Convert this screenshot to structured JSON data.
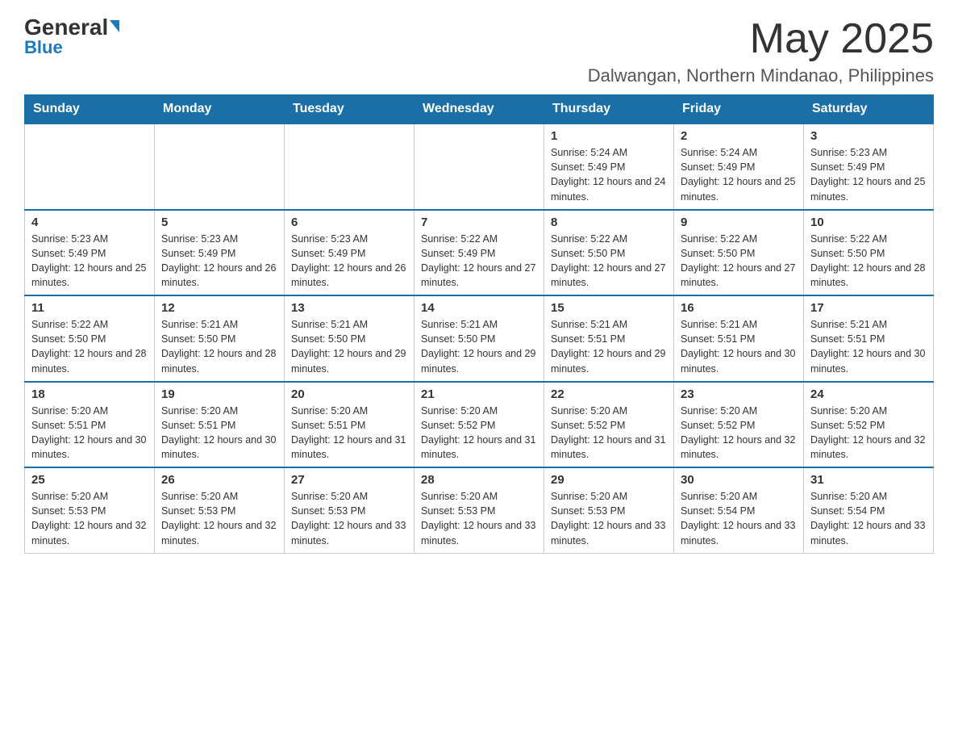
{
  "logo": {
    "part1": "General",
    "part2": "Blue"
  },
  "header": {
    "month": "May 2025",
    "location": "Dalwangan, Northern Mindanao, Philippines"
  },
  "days_of_week": [
    "Sunday",
    "Monday",
    "Tuesday",
    "Wednesday",
    "Thursday",
    "Friday",
    "Saturday"
  ],
  "weeks": [
    {
      "days": [
        {
          "num": "",
          "info": ""
        },
        {
          "num": "",
          "info": ""
        },
        {
          "num": "",
          "info": ""
        },
        {
          "num": "",
          "info": ""
        },
        {
          "num": "1",
          "info": "Sunrise: 5:24 AM\nSunset: 5:49 PM\nDaylight: 12 hours and 24 minutes."
        },
        {
          "num": "2",
          "info": "Sunrise: 5:24 AM\nSunset: 5:49 PM\nDaylight: 12 hours and 25 minutes."
        },
        {
          "num": "3",
          "info": "Sunrise: 5:23 AM\nSunset: 5:49 PM\nDaylight: 12 hours and 25 minutes."
        }
      ]
    },
    {
      "days": [
        {
          "num": "4",
          "info": "Sunrise: 5:23 AM\nSunset: 5:49 PM\nDaylight: 12 hours and 25 minutes."
        },
        {
          "num": "5",
          "info": "Sunrise: 5:23 AM\nSunset: 5:49 PM\nDaylight: 12 hours and 26 minutes."
        },
        {
          "num": "6",
          "info": "Sunrise: 5:23 AM\nSunset: 5:49 PM\nDaylight: 12 hours and 26 minutes."
        },
        {
          "num": "7",
          "info": "Sunrise: 5:22 AM\nSunset: 5:49 PM\nDaylight: 12 hours and 27 minutes."
        },
        {
          "num": "8",
          "info": "Sunrise: 5:22 AM\nSunset: 5:50 PM\nDaylight: 12 hours and 27 minutes."
        },
        {
          "num": "9",
          "info": "Sunrise: 5:22 AM\nSunset: 5:50 PM\nDaylight: 12 hours and 27 minutes."
        },
        {
          "num": "10",
          "info": "Sunrise: 5:22 AM\nSunset: 5:50 PM\nDaylight: 12 hours and 28 minutes."
        }
      ]
    },
    {
      "days": [
        {
          "num": "11",
          "info": "Sunrise: 5:22 AM\nSunset: 5:50 PM\nDaylight: 12 hours and 28 minutes."
        },
        {
          "num": "12",
          "info": "Sunrise: 5:21 AM\nSunset: 5:50 PM\nDaylight: 12 hours and 28 minutes."
        },
        {
          "num": "13",
          "info": "Sunrise: 5:21 AM\nSunset: 5:50 PM\nDaylight: 12 hours and 29 minutes."
        },
        {
          "num": "14",
          "info": "Sunrise: 5:21 AM\nSunset: 5:50 PM\nDaylight: 12 hours and 29 minutes."
        },
        {
          "num": "15",
          "info": "Sunrise: 5:21 AM\nSunset: 5:51 PM\nDaylight: 12 hours and 29 minutes."
        },
        {
          "num": "16",
          "info": "Sunrise: 5:21 AM\nSunset: 5:51 PM\nDaylight: 12 hours and 30 minutes."
        },
        {
          "num": "17",
          "info": "Sunrise: 5:21 AM\nSunset: 5:51 PM\nDaylight: 12 hours and 30 minutes."
        }
      ]
    },
    {
      "days": [
        {
          "num": "18",
          "info": "Sunrise: 5:20 AM\nSunset: 5:51 PM\nDaylight: 12 hours and 30 minutes."
        },
        {
          "num": "19",
          "info": "Sunrise: 5:20 AM\nSunset: 5:51 PM\nDaylight: 12 hours and 30 minutes."
        },
        {
          "num": "20",
          "info": "Sunrise: 5:20 AM\nSunset: 5:51 PM\nDaylight: 12 hours and 31 minutes."
        },
        {
          "num": "21",
          "info": "Sunrise: 5:20 AM\nSunset: 5:52 PM\nDaylight: 12 hours and 31 minutes."
        },
        {
          "num": "22",
          "info": "Sunrise: 5:20 AM\nSunset: 5:52 PM\nDaylight: 12 hours and 31 minutes."
        },
        {
          "num": "23",
          "info": "Sunrise: 5:20 AM\nSunset: 5:52 PM\nDaylight: 12 hours and 32 minutes."
        },
        {
          "num": "24",
          "info": "Sunrise: 5:20 AM\nSunset: 5:52 PM\nDaylight: 12 hours and 32 minutes."
        }
      ]
    },
    {
      "days": [
        {
          "num": "25",
          "info": "Sunrise: 5:20 AM\nSunset: 5:53 PM\nDaylight: 12 hours and 32 minutes."
        },
        {
          "num": "26",
          "info": "Sunrise: 5:20 AM\nSunset: 5:53 PM\nDaylight: 12 hours and 32 minutes."
        },
        {
          "num": "27",
          "info": "Sunrise: 5:20 AM\nSunset: 5:53 PM\nDaylight: 12 hours and 33 minutes."
        },
        {
          "num": "28",
          "info": "Sunrise: 5:20 AM\nSunset: 5:53 PM\nDaylight: 12 hours and 33 minutes."
        },
        {
          "num": "29",
          "info": "Sunrise: 5:20 AM\nSunset: 5:53 PM\nDaylight: 12 hours and 33 minutes."
        },
        {
          "num": "30",
          "info": "Sunrise: 5:20 AM\nSunset: 5:54 PM\nDaylight: 12 hours and 33 minutes."
        },
        {
          "num": "31",
          "info": "Sunrise: 5:20 AM\nSunset: 5:54 PM\nDaylight: 12 hours and 33 minutes."
        }
      ]
    }
  ]
}
